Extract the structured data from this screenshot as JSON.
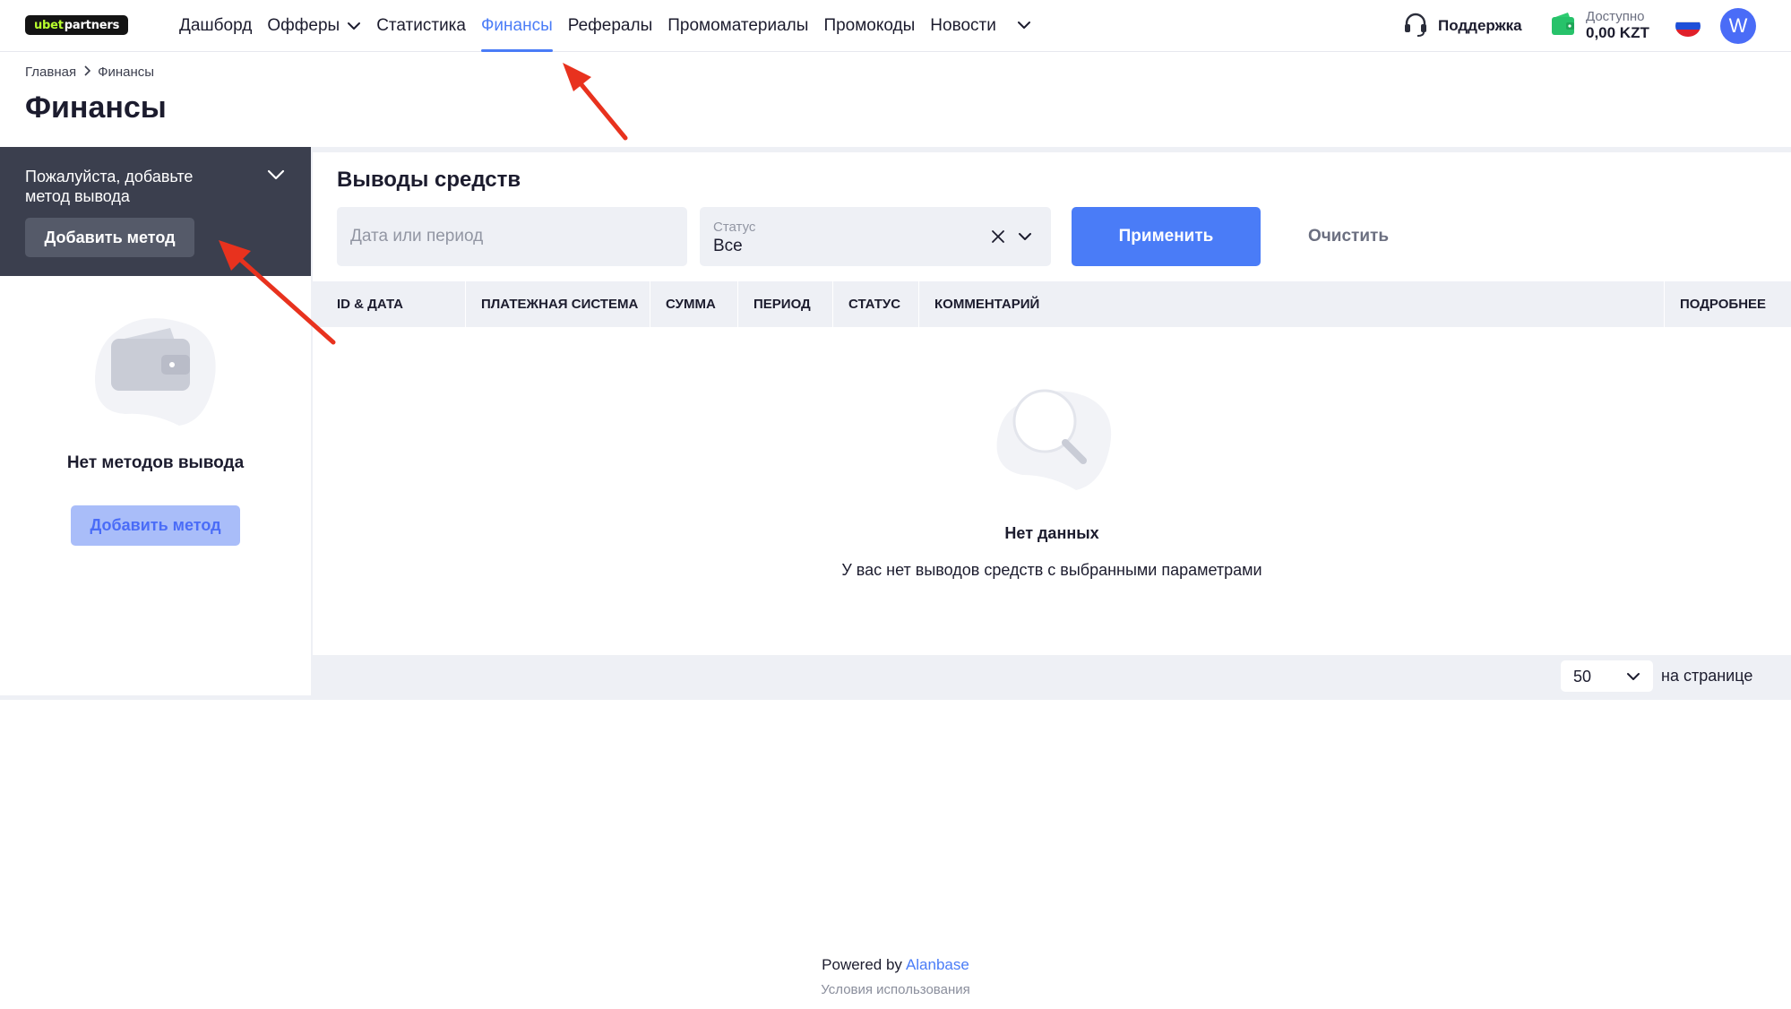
{
  "header": {
    "logo": {
      "part1": "ubet",
      "part2": "partners"
    },
    "nav": [
      {
        "label": "Дашборд",
        "active": false,
        "caret": false
      },
      {
        "label": "Офферы",
        "active": false,
        "caret": true
      },
      {
        "label": "Статистика",
        "active": false,
        "caret": false
      },
      {
        "label": "Финансы",
        "active": true,
        "caret": false
      },
      {
        "label": "Рефералы",
        "active": false,
        "caret": false
      },
      {
        "label": "Промоматериалы",
        "active": false,
        "caret": false
      },
      {
        "label": "Промокоды",
        "active": false,
        "caret": false
      },
      {
        "label": "Новости",
        "active": false,
        "caret": false
      }
    ],
    "support_label": "Поддержка",
    "balance": {
      "caption": "Доступно",
      "amount": "0,00 KZT"
    },
    "language": "ru",
    "avatar_letter": "W"
  },
  "breadcrumb": {
    "home": "Главная",
    "current": "Финансы"
  },
  "page_title": "Финансы",
  "methods_panel": {
    "prompt": "Пожалуйста, добавьте метод вывода",
    "add_button": "Добавить метод",
    "empty_text": "Нет методов вывода",
    "empty_add_button": "Добавить метод"
  },
  "withdrawals": {
    "title": "Выводы средств",
    "date_placeholder": "Дата или период",
    "status_caption": "Статус",
    "status_value": "Все",
    "apply_button": "Применить",
    "clear_button": "Очистить",
    "columns": {
      "id_date": "ID & ДАТА",
      "payment_system": "ПЛАТЕЖНАЯ СИСТЕМА",
      "amount": "СУММА",
      "period": "ПЕРИОД",
      "status": "СТАТУС",
      "comment": "КОММЕНТАРИЙ",
      "details": "ПОДРОБНЕЕ"
    },
    "empty_title": "Нет данных",
    "empty_description": "У вас нет выводов средств с выбранными параметрами",
    "per_page_value": "50",
    "per_page_label": "на странице"
  },
  "footer": {
    "powered_by": "Powered by",
    "powered_link": "Alanbase",
    "terms": "Условия использования"
  },
  "colors": {
    "accent": "#4a7cf7",
    "dark_panel": "#3b3f4e",
    "band": "#eef0f5",
    "annotation_arrow": "#e8321e"
  }
}
